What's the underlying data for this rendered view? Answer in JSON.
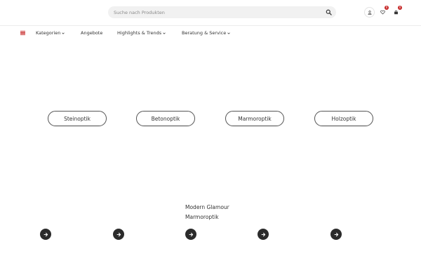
{
  "header": {
    "search": {
      "placeholder": "Suche nach Produkten",
      "value": ""
    },
    "icons": [
      "search-icon",
      "user-icon",
      "heart-icon",
      "cart-icon"
    ],
    "wishlist_count": "0",
    "cart_count": "0"
  },
  "nav": {
    "items": [
      {
        "label": "Kategorien",
        "dropdown": true
      },
      {
        "label": "Angebote",
        "dropdown": false
      },
      {
        "label": "Highlights & Trends",
        "dropdown": true
      },
      {
        "label": "Beratung & Service",
        "dropdown": true
      }
    ]
  },
  "categories": [
    "Steinoptik",
    "Betonoptik",
    "Marmoroptik",
    "Holzoptik"
  ],
  "slide": {
    "title": "Modern Glamour",
    "subtitle": "Marmoroptik"
  },
  "colors": {
    "accent": "#c62828",
    "dark": "#2b2b2b",
    "search_bg": "#f1f1f1"
  }
}
